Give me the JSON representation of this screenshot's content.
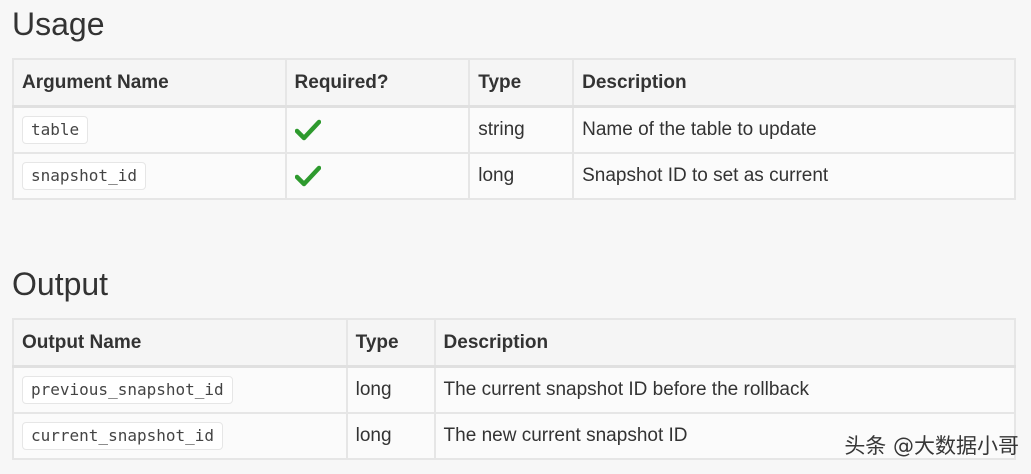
{
  "usage": {
    "title": "Usage",
    "headers": [
      "Argument Name",
      "Required?",
      "Type",
      "Description"
    ],
    "rows": [
      {
        "name": "table",
        "required_icon": "checkmark-icon",
        "type": "string",
        "description": "Name of the table to update"
      },
      {
        "name": "snapshot_id",
        "required_icon": "checkmark-icon",
        "type": "long",
        "description": "Snapshot ID to set as current"
      }
    ],
    "check_color": "#2e9a2e"
  },
  "output": {
    "title": "Output",
    "headers": [
      "Output Name",
      "Type",
      "Description"
    ],
    "rows": [
      {
        "name": "previous_snapshot_id",
        "type": "long",
        "description": "The current snapshot ID before the rollback"
      },
      {
        "name": "current_snapshot_id",
        "type": "long",
        "description": "The new current snapshot ID"
      }
    ]
  },
  "watermark": "头条 @大数据小哥"
}
